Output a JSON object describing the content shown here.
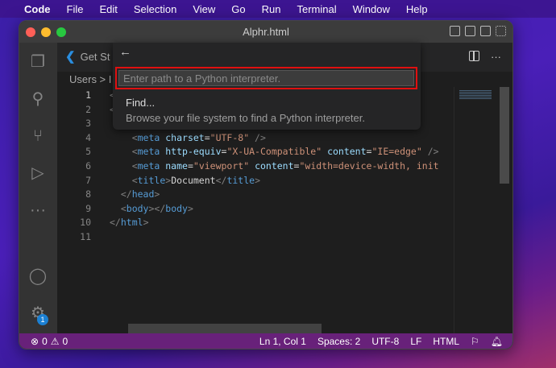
{
  "menubar": {
    "app": "Code",
    "items": [
      "File",
      "Edit",
      "Selection",
      "View",
      "Go",
      "Run",
      "Terminal",
      "Window",
      "Help"
    ]
  },
  "window": {
    "title": "Alphr.html"
  },
  "tab": {
    "label": "Get St"
  },
  "breadcrumb": "Users > I",
  "editor": {
    "lines": [
      {
        "n": "1",
        "parts": [
          [
            "pun",
            "<"
          ]
        ]
      },
      {
        "n": "2",
        "parts": [
          [
            "pun",
            "<"
          ]
        ]
      },
      {
        "n": "3",
        "parts": []
      },
      {
        "n": "4",
        "parts": [
          [
            "pun",
            "    <"
          ],
          [
            "tag",
            "meta"
          ],
          [
            "att",
            " charset"
          ],
          [
            "txt",
            "="
          ],
          [
            "str",
            "\"UTF-8\""
          ],
          [
            "pun",
            " />"
          ]
        ]
      },
      {
        "n": "5",
        "parts": [
          [
            "pun",
            "    <"
          ],
          [
            "tag",
            "meta"
          ],
          [
            "att",
            " http-equiv"
          ],
          [
            "txt",
            "="
          ],
          [
            "str",
            "\"X-UA-Compatible\""
          ],
          [
            "att",
            " content"
          ],
          [
            "txt",
            "="
          ],
          [
            "str",
            "\"IE=edge\""
          ],
          [
            "pun",
            " />"
          ]
        ]
      },
      {
        "n": "6",
        "parts": [
          [
            "pun",
            "    <"
          ],
          [
            "tag",
            "meta"
          ],
          [
            "att",
            " name"
          ],
          [
            "txt",
            "="
          ],
          [
            "str",
            "\"viewport\""
          ],
          [
            "att",
            " content"
          ],
          [
            "txt",
            "="
          ],
          [
            "str",
            "\"width=device-width, init"
          ]
        ]
      },
      {
        "n": "7",
        "parts": [
          [
            "pun",
            "    <"
          ],
          [
            "tag",
            "title"
          ],
          [
            "pun",
            ">"
          ],
          [
            "txt",
            "Document"
          ],
          [
            "pun",
            "</"
          ],
          [
            "tag",
            "title"
          ],
          [
            "pun",
            ">"
          ]
        ]
      },
      {
        "n": "8",
        "parts": [
          [
            "pun",
            "  </"
          ],
          [
            "tag",
            "head"
          ],
          [
            "pun",
            ">"
          ]
        ]
      },
      {
        "n": "9",
        "parts": [
          [
            "pun",
            "  <"
          ],
          [
            "tag",
            "body"
          ],
          [
            "pun",
            "></"
          ],
          [
            "tag",
            "body"
          ],
          [
            "pun",
            ">"
          ]
        ]
      },
      {
        "n": "10",
        "parts": [
          [
            "pun",
            "</"
          ],
          [
            "tag",
            "html"
          ],
          [
            "pun",
            ">"
          ]
        ]
      },
      {
        "n": "11",
        "parts": []
      }
    ]
  },
  "popup": {
    "back": "←",
    "placeholder": "Enter path to a Python interpreter.",
    "item_title": "Find...",
    "item_desc": "Browse your file system to find a Python interpreter."
  },
  "settings_badge": "1",
  "status": {
    "errors": "0",
    "warnings": "0",
    "position": "Ln 1, Col 1",
    "spaces": "Spaces: 2",
    "encoding": "UTF-8",
    "eol": "LF",
    "language": "HTML"
  },
  "colors": {
    "accent": "#68217a",
    "highlight": "#e01010"
  }
}
